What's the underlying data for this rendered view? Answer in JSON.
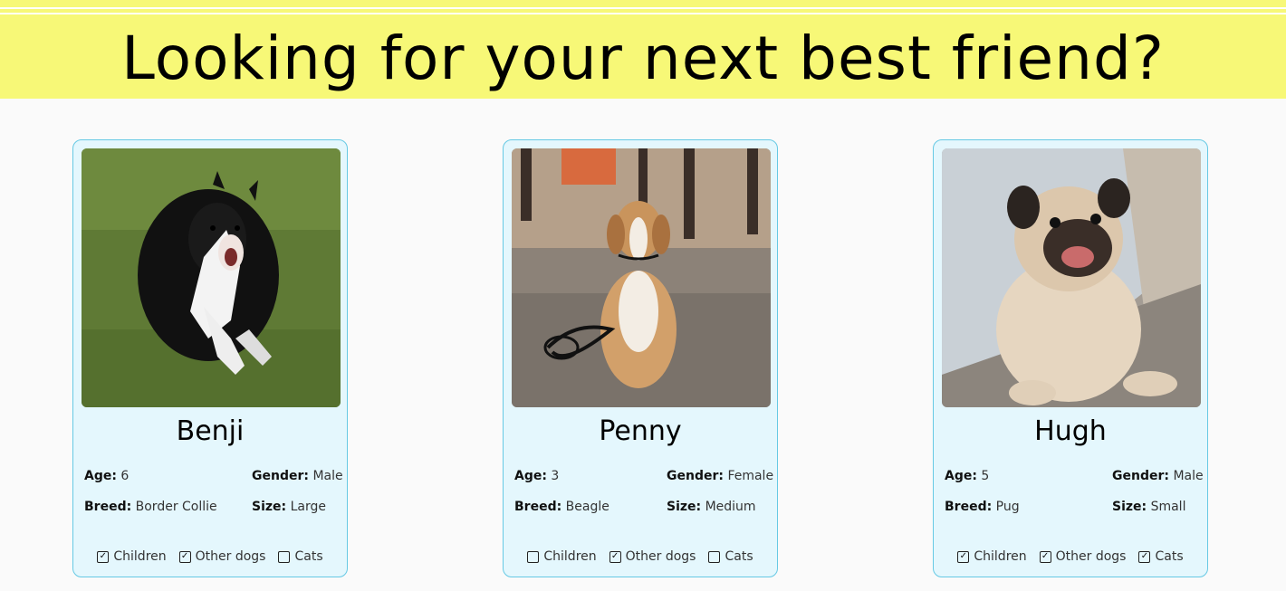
{
  "header": {
    "title": "Looking for your next best friend?",
    "background": "#f7f877"
  },
  "dogs": [
    {
      "name": "Benji",
      "age_label": "Age:",
      "age": "6",
      "gender_label": "Gender:",
      "gender": "Male",
      "breed_label": "Breed:",
      "breed": "Border Collie",
      "size_label": "Size:",
      "size": "Large",
      "compat": [
        {
          "label": "Children",
          "checked": true
        },
        {
          "label": "Other dogs",
          "checked": true
        },
        {
          "label": "Cats",
          "checked": false
        }
      ]
    },
    {
      "name": "Penny",
      "age_label": "Age:",
      "age": "3",
      "gender_label": "Gender:",
      "gender": "Female",
      "breed_label": "Breed:",
      "breed": "Beagle",
      "size_label": "Size:",
      "size": "Medium",
      "compat": [
        {
          "label": "Children",
          "checked": false
        },
        {
          "label": "Other dogs",
          "checked": true
        },
        {
          "label": "Cats",
          "checked": false
        }
      ]
    },
    {
      "name": "Hugh",
      "age_label": "Age:",
      "age": "5",
      "gender_label": "Gender:",
      "gender": "Male",
      "breed_label": "Breed:",
      "breed": "Pug",
      "size_label": "Size:",
      "size": "Small",
      "compat": [
        {
          "label": "Children",
          "checked": true
        },
        {
          "label": "Other dogs",
          "checked": true
        },
        {
          "label": "Cats",
          "checked": true
        }
      ]
    }
  ],
  "icons": {
    "checked": "☑-checkbox-icon",
    "unchecked": "☐-checkbox-icon"
  },
  "colors": {
    "card_bg": "#e4f7fd",
    "card_border": "#66c9e4"
  }
}
